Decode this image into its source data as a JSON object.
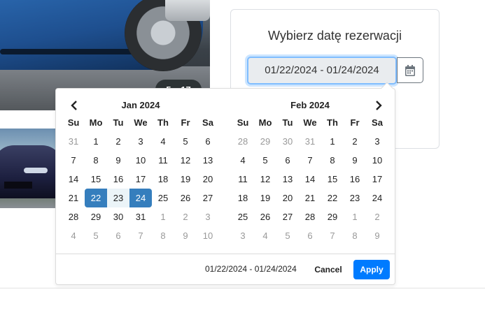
{
  "gallery": {
    "badge_text": "5 z 17"
  },
  "reservation": {
    "title": "Wybierz datę rezerwacji",
    "date_range_value": "01/22/2024 - 01/24/2024"
  },
  "picker": {
    "months": [
      {
        "name": "Jan 2024",
        "weekdays": [
          "Su",
          "Mo",
          "Tu",
          "We",
          "Th",
          "Fr",
          "Sa"
        ],
        "days": [
          {
            "d": "31",
            "off": true
          },
          {
            "d": "1"
          },
          {
            "d": "2"
          },
          {
            "d": "3"
          },
          {
            "d": "4"
          },
          {
            "d": "5"
          },
          {
            "d": "6"
          },
          {
            "d": "7"
          },
          {
            "d": "8"
          },
          {
            "d": "9"
          },
          {
            "d": "10"
          },
          {
            "d": "11"
          },
          {
            "d": "12"
          },
          {
            "d": "13"
          },
          {
            "d": "14"
          },
          {
            "d": "15"
          },
          {
            "d": "16"
          },
          {
            "d": "17"
          },
          {
            "d": "18"
          },
          {
            "d": "19"
          },
          {
            "d": "20"
          },
          {
            "d": "21"
          },
          {
            "d": "22",
            "state": "start"
          },
          {
            "d": "23",
            "state": "range"
          },
          {
            "d": "24",
            "state": "end"
          },
          {
            "d": "25"
          },
          {
            "d": "26"
          },
          {
            "d": "27"
          },
          {
            "d": "28"
          },
          {
            "d": "29"
          },
          {
            "d": "30"
          },
          {
            "d": "31"
          },
          {
            "d": "1",
            "off": true
          },
          {
            "d": "2",
            "off": true
          },
          {
            "d": "3",
            "off": true
          },
          {
            "d": "4",
            "off": true
          },
          {
            "d": "5",
            "off": true
          },
          {
            "d": "6",
            "off": true
          },
          {
            "d": "7",
            "off": true
          },
          {
            "d": "8",
            "off": true
          },
          {
            "d": "9",
            "off": true
          },
          {
            "d": "10",
            "off": true
          }
        ]
      },
      {
        "name": "Feb 2024",
        "weekdays": [
          "Su",
          "Mo",
          "Tu",
          "We",
          "Th",
          "Fr",
          "Sa"
        ],
        "days": [
          {
            "d": "28",
            "off": true
          },
          {
            "d": "29",
            "off": true
          },
          {
            "d": "30",
            "off": true
          },
          {
            "d": "31",
            "off": true
          },
          {
            "d": "1"
          },
          {
            "d": "2"
          },
          {
            "d": "3"
          },
          {
            "d": "4"
          },
          {
            "d": "5"
          },
          {
            "d": "6"
          },
          {
            "d": "7"
          },
          {
            "d": "8"
          },
          {
            "d": "9"
          },
          {
            "d": "10"
          },
          {
            "d": "11"
          },
          {
            "d": "12"
          },
          {
            "d": "13"
          },
          {
            "d": "14"
          },
          {
            "d": "15"
          },
          {
            "d": "16"
          },
          {
            "d": "17"
          },
          {
            "d": "18"
          },
          {
            "d": "19"
          },
          {
            "d": "20"
          },
          {
            "d": "21"
          },
          {
            "d": "22"
          },
          {
            "d": "23"
          },
          {
            "d": "24"
          },
          {
            "d": "25"
          },
          {
            "d": "26"
          },
          {
            "d": "27"
          },
          {
            "d": "28"
          },
          {
            "d": "29"
          },
          {
            "d": "1",
            "off": true
          },
          {
            "d": "2",
            "off": true
          },
          {
            "d": "3",
            "off": true
          },
          {
            "d": "4",
            "off": true
          },
          {
            "d": "5",
            "off": true
          },
          {
            "d": "6",
            "off": true
          },
          {
            "d": "7",
            "off": true
          },
          {
            "d": "8",
            "off": true
          },
          {
            "d": "9",
            "off": true
          }
        ]
      }
    ],
    "selected_range_text": "01/22/2024 - 01/24/2024",
    "cancel_label": "Cancel",
    "apply_label": "Apply",
    "prev_icon": "chevron-left-icon",
    "next_icon": "chevron-right-icon"
  },
  "colors": {
    "selected": "#357ebd",
    "in_range": "#ebf4f8",
    "apply": "#007bff",
    "focus_border": "#80bdff"
  }
}
